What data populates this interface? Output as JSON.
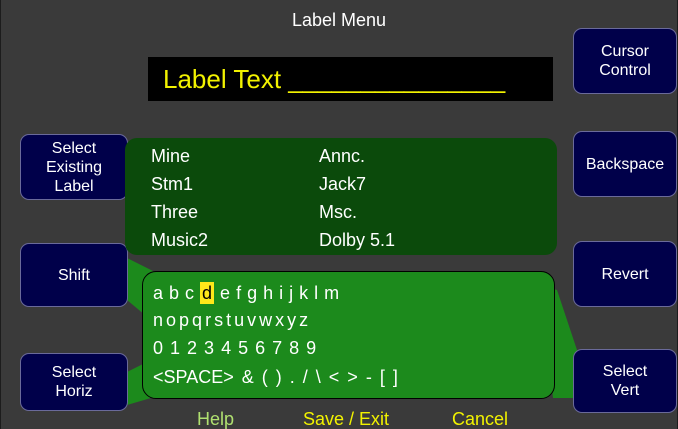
{
  "title": "Label Menu",
  "label_text": "Label Text _______________",
  "buttons": {
    "select_existing": "Select\nExisting\nLabel",
    "shift": "Shift",
    "select_horiz": "Select\nHoriz",
    "cursor_control": "Cursor\nControl",
    "backspace": "Backspace",
    "revert": "Revert",
    "select_vert": "Select\nVert"
  },
  "labels_list": {
    "col1": [
      "Mine",
      "Stm1",
      "Three",
      "Music2"
    ],
    "col2": [
      "Annc.",
      "Jack7",
      "Msc.",
      "Dolby 5.1"
    ]
  },
  "keyboard": {
    "rows": [
      [
        "a",
        "b",
        "c",
        "d",
        "e",
        "f",
        "g",
        "h",
        "i",
        "j",
        "k",
        "l",
        "m"
      ],
      [
        "n",
        "o",
        "p",
        "q",
        "r",
        "s",
        "t",
        "u",
        "v",
        "w",
        "x",
        "y",
        "z"
      ],
      [
        "0",
        "1",
        "2",
        "3",
        "4",
        "5",
        "6",
        "7",
        "8",
        "9"
      ],
      [
        "<SPACE>",
        "&",
        "(",
        ")",
        ".",
        "/",
        "\\",
        "<",
        ">",
        "-",
        "[",
        "]"
      ]
    ],
    "selected_key": "d"
  },
  "bottom": {
    "help": "Help",
    "save_exit": "Save / Exit",
    "cancel": "Cancel"
  },
  "colors": {
    "background": "#3a3a3a",
    "button": "#00004a",
    "list_panel": "#0b4a0b",
    "keyboard_panel": "#1c8a1c",
    "label_text": "#f2f200",
    "selected_key": "#ffe81a",
    "help_text": "#b0e070",
    "save_exit_text": "#f2f200",
    "cancel_text": "#f2f200"
  }
}
